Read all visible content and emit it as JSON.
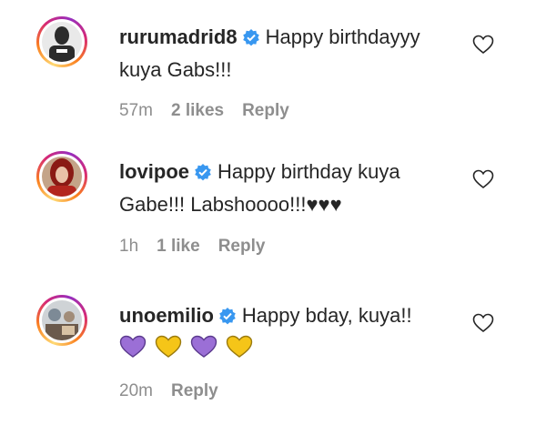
{
  "comments": [
    {
      "username": "rurumadrid8",
      "text": "Happy birthdayyy kuya Gabs!!!",
      "time": "57m",
      "likes": "2 likes",
      "reply": "Reply",
      "avatar_icon": "avatar-photo-icon"
    },
    {
      "username": "lovipoe",
      "text": "Happy birthday kuya Gabe!!! Labshoooo!!!♥♥♥",
      "time": "1h",
      "likes": "1 like",
      "reply": "Reply",
      "avatar_icon": "avatar-photo-icon"
    },
    {
      "username": "unoemilio",
      "text": "Happy bday, kuya!!",
      "emojis": [
        "purple-heart",
        "yellow-heart",
        "purple-heart",
        "yellow-heart"
      ],
      "time": "20m",
      "reply": "Reply",
      "avatar_icon": "avatar-photo-icon"
    }
  ],
  "colors": {
    "text": "#262626",
    "meta": "#8e8e8e",
    "verified": "#3897f0",
    "purple_heart": "#9b6fd6",
    "yellow_heart": "#f5c518"
  }
}
